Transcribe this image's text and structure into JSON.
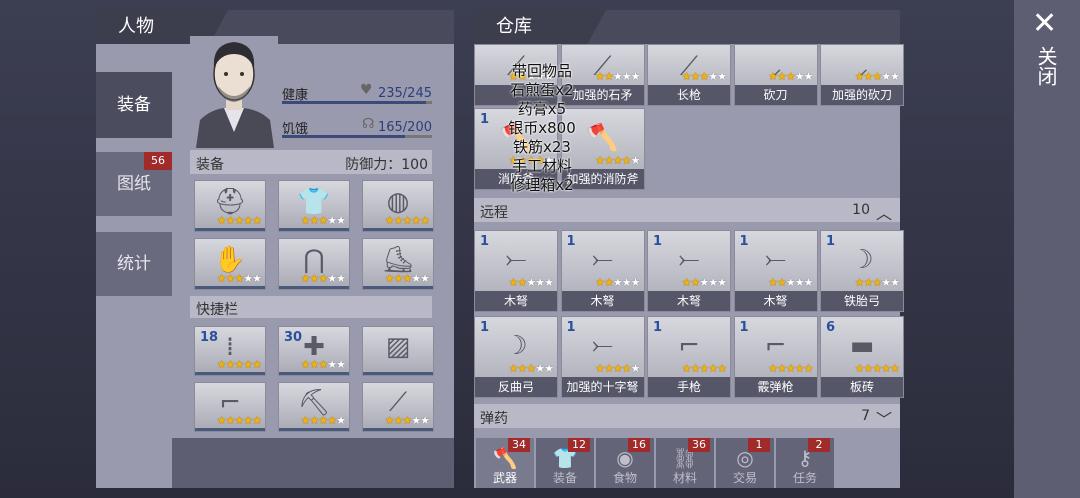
{
  "character": {
    "title": "人物",
    "side_tabs": [
      {
        "label": "装备"
      },
      {
        "label": "图纸",
        "badge": "56"
      },
      {
        "label": "统计"
      }
    ],
    "health": {
      "label": "健康",
      "value": "235/245",
      "fraction": 0.96
    },
    "hunger": {
      "label": "饥饿",
      "value": "165/200",
      "fraction": 0.82
    },
    "equipment": {
      "label": "装备",
      "defense": "防御力：100"
    },
    "equip_slots": [
      {
        "icon": "helmet-icon",
        "stars": 5
      },
      {
        "icon": "vest-icon",
        "stars": 3
      },
      {
        "icon": "mask-icon",
        "stars": 5
      },
      {
        "icon": "gloves-icon",
        "stars": 3
      },
      {
        "icon": "pants-icon",
        "stars": 3
      },
      {
        "icon": "boots-icon",
        "stars": 3
      }
    ],
    "hotbar": {
      "label": "快捷栏"
    },
    "hotbar_slots": [
      {
        "icon": "bullets-icon",
        "count": "18",
        "stars": 5
      },
      {
        "icon": "bandage-icon",
        "count": "30",
        "stars": 3
      },
      {
        "icon": "locked-slot-icon",
        "count": "",
        "stars": 0
      },
      {
        "icon": "shotgun-icon",
        "count": "",
        "stars": 5
      },
      {
        "icon": "pickaxe-icon",
        "count": "",
        "stars": 4
      },
      {
        "icon": "spear-icon",
        "count": "",
        "stars": 3
      }
    ]
  },
  "storage": {
    "title": "仓库",
    "overlay_lines": [
      "带回物品",
      "石煎蛋x2",
      "药膏x5",
      "银币x800",
      "铁筋x23",
      "手工材料",
      "修理箱x2"
    ],
    "melee_row1": [
      {
        "name": "",
        "stars": 2,
        "icon": "spear-icon"
      },
      {
        "name": "加强的石矛",
        "stars": 2,
        "icon": "spear-icon"
      },
      {
        "name": "长枪",
        "stars": 3,
        "icon": "spear-icon"
      },
      {
        "name": "砍刀",
        "stars": 3,
        "icon": "machete-icon"
      },
      {
        "name": "加强的砍刀",
        "stars": 3,
        "icon": "machete-icon"
      }
    ],
    "melee_row2": [
      {
        "name": "消防斧",
        "count": "1",
        "stars": 4,
        "icon": "axe-icon"
      },
      {
        "name": "加强的消防斧",
        "count": "",
        "stars": 4,
        "icon": "axe-icon"
      }
    ],
    "ranged": {
      "label": "远程",
      "count": "10"
    },
    "ranged_items": [
      {
        "name": "木弩",
        "count": "1",
        "stars": 2,
        "icon": "crossbow-icon"
      },
      {
        "name": "木弩",
        "count": "1",
        "stars": 2,
        "icon": "crossbow-icon"
      },
      {
        "name": "木弩",
        "count": "1",
        "stars": 2,
        "icon": "crossbow-icon"
      },
      {
        "name": "木弩",
        "count": "1",
        "stars": 2,
        "icon": "crossbow-icon"
      },
      {
        "name": "铁胎弓",
        "count": "1",
        "stars": 3,
        "icon": "bow-icon"
      },
      {
        "name": "反曲弓",
        "count": "1",
        "stars": 3,
        "icon": "bow-icon"
      },
      {
        "name": "加强的十字弩",
        "count": "1",
        "stars": 4,
        "icon": "crossbow-icon"
      },
      {
        "name": "手枪",
        "count": "1",
        "stars": 5,
        "icon": "pistol-icon"
      },
      {
        "name": "霰弹枪",
        "count": "1",
        "stars": 5,
        "icon": "shotgun-icon"
      },
      {
        "name": "板砖",
        "count": "6",
        "stars": 5,
        "icon": "brick-icon"
      }
    ],
    "ammo": {
      "label": "弹药",
      "count": "7"
    },
    "bottom_tabs": [
      {
        "label": "武器",
        "badge": "34",
        "icon": "axe-icon"
      },
      {
        "label": "装备",
        "badge": "12",
        "icon": "shirt-icon"
      },
      {
        "label": "食物",
        "badge": "16",
        "icon": "food-icon"
      },
      {
        "label": "材料",
        "badge": "36",
        "icon": "material-icon"
      },
      {
        "label": "交易",
        "badge": "1",
        "icon": "coin-icon"
      },
      {
        "label": "任务",
        "badge": "2",
        "icon": "key-icon"
      }
    ]
  },
  "close": {
    "label": "关闭"
  }
}
